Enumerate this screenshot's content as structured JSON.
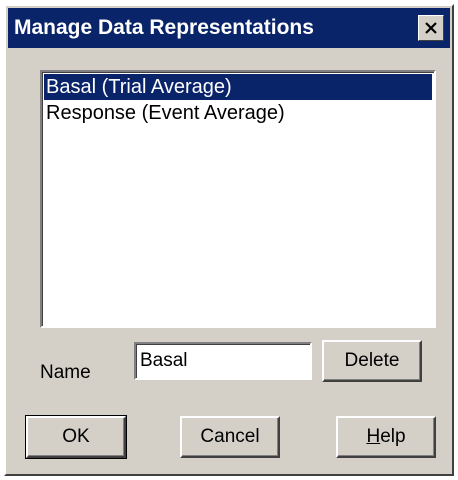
{
  "dialog": {
    "title": "Manage Data Representations"
  },
  "list": {
    "items": [
      {
        "label": "Basal (Trial Average)",
        "selected": true
      },
      {
        "label": "Response (Event Average)",
        "selected": false
      }
    ]
  },
  "name_field": {
    "label": "Name",
    "value": "Basal"
  },
  "buttons": {
    "delete": "Delete",
    "ok": "OK",
    "cancel": "Cancel",
    "help_mnemonic": "H",
    "help_rest": "elp"
  },
  "colors": {
    "titlebar": "#0a246a",
    "face": "#d4d0c8",
    "selection": "#0a246a"
  },
  "icons": {
    "close": "close-icon"
  }
}
